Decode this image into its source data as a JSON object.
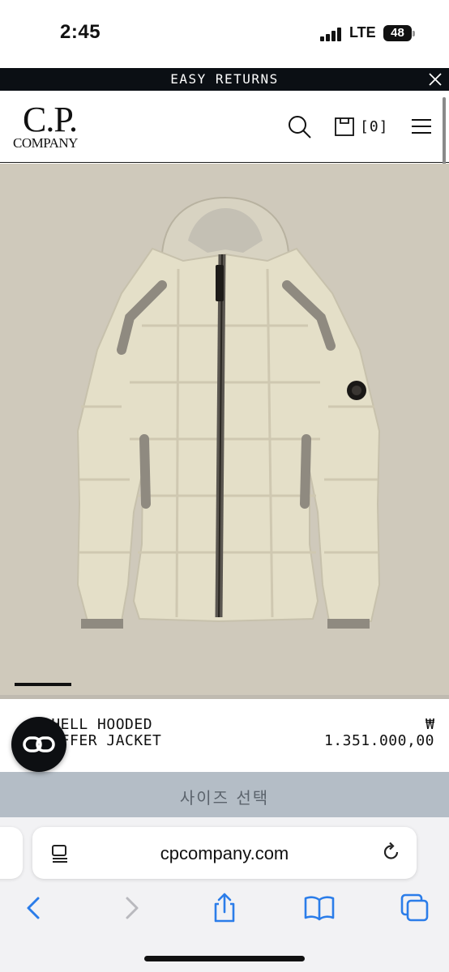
{
  "status_bar": {
    "time": "2:45",
    "network": "LTE",
    "battery": "48"
  },
  "announcement": {
    "text": "EASY RETURNS",
    "close_icon": "close-icon"
  },
  "header": {
    "logo_top": "C.P.",
    "logo_bottom": "COMPANY",
    "cart_count": "[0]",
    "icons": [
      "search-icon",
      "bag-icon",
      "menu-icon"
    ]
  },
  "product": {
    "name": "D.D. SHELL HOODED\nPUFFER JACKET",
    "name_visible": "   SHELL HOODED\n   PUFFER JACKET",
    "currency": "₩",
    "price": "1.351.000,00",
    "carousel_progress": 0.13,
    "image_background": "#cfc9bb",
    "jacket_color": "#e4dfc8"
  },
  "size_select": {
    "label": "사이즈 선택",
    "background": "#b4bdc6"
  },
  "browser": {
    "url": "cpcompany.com",
    "accent": "#2b7de9",
    "toolbar_icons": [
      "back-icon",
      "forward-icon",
      "share-icon",
      "bookmarks-icon",
      "tabs-icon"
    ]
  }
}
